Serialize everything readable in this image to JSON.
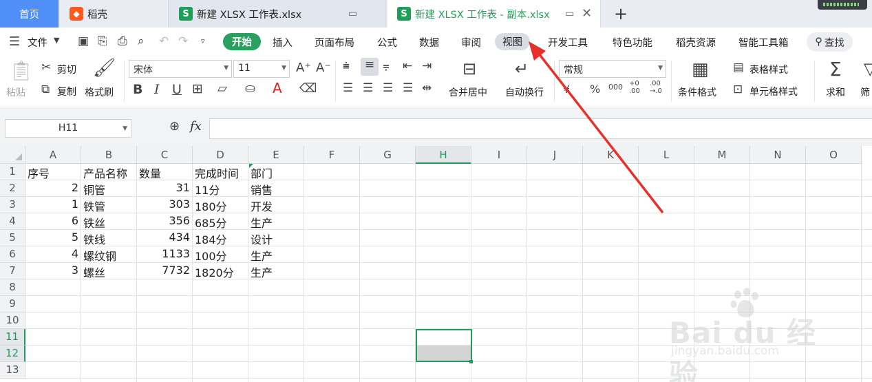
{
  "tabs": {
    "home": "首页",
    "daoke": "稻壳",
    "file1": "新建 XLSX 工作表.xlsx",
    "file2": "新建 XLSX 工作表 - 副本.xlsx"
  },
  "menu": {
    "file": "文件",
    "items": [
      "开始",
      "插入",
      "页面布局",
      "公式",
      "数据",
      "审阅",
      "视图",
      "开发工具",
      "特色功能",
      "稻壳资源",
      "智能工具箱"
    ],
    "search": "查找"
  },
  "ribbon": {
    "paste": "粘贴",
    "cut": "剪切",
    "copy": "复制",
    "format_painter": "格式刷",
    "font": "宋体",
    "font_size": "11",
    "merge_center": "合并居中",
    "wrap_text": "自动换行",
    "number_format": "常规",
    "conditional_format": "条件格式",
    "table_style": "表格样式",
    "cell_style": "单元格样式",
    "sum": "求和",
    "filter": "筛"
  },
  "formula_bar": {
    "name_box": "H11",
    "fx": "fx",
    "value": ""
  },
  "sheet": {
    "columns": [
      "A",
      "B",
      "C",
      "D",
      "E",
      "F",
      "G",
      "H",
      "I",
      "J",
      "K",
      "L",
      "M",
      "N",
      "O"
    ],
    "selected_column": "H",
    "rows": [
      "1",
      "2",
      "3",
      "4",
      "5",
      "6",
      "7",
      "8",
      "9",
      "10",
      "11",
      "12",
      "13"
    ],
    "selected_rows": [
      "11",
      "12"
    ],
    "data": [
      [
        "序号",
        "产品名称",
        "数量",
        "完成时间",
        "部门"
      ],
      [
        "2",
        "铜管",
        "31",
        "11分",
        "销售"
      ],
      [
        "1",
        "铁管",
        "303",
        "180分",
        "开发"
      ],
      [
        "6",
        "铁丝",
        "356",
        "685分",
        "生产"
      ],
      [
        "5",
        "铁线",
        "434",
        "184分",
        "设计"
      ],
      [
        "4",
        "螺纹钢",
        "1133",
        "100分",
        "生产"
      ],
      [
        "3",
        "螺丝",
        "7732",
        "1820分",
        "生产"
      ]
    ]
  },
  "watermark": {
    "main": "Bai du 经验",
    "sub": "jingyan.baidu.com"
  },
  "colors": {
    "accent_green": "#1f9e5b",
    "home_tab_blue": "#4f8ff7",
    "annotation_arrow": "#e8302a"
  }
}
